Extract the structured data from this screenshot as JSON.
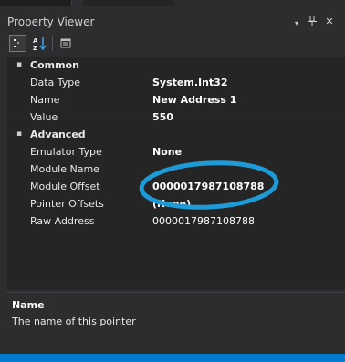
{
  "window": {
    "title": "Property Viewer"
  },
  "titlebar_buttons": {
    "menu_icon": "▾",
    "pin_icon": "ᛘ",
    "close_icon": "✕"
  },
  "toolbar": {
    "categorized_icon": "categorized-icon",
    "alphabetical_icon": "alphabetical-icon",
    "pages_icon": "property-pages-icon"
  },
  "colors": {
    "accent": "#007acc",
    "highlight_ellipse": "#1e9bd7",
    "background": "#2d2d30",
    "grid": "#252526"
  },
  "categories": [
    {
      "name": "Common",
      "expander": "▪",
      "properties": [
        {
          "name": "Data Type",
          "value": "System.Int32"
        },
        {
          "name": "Name",
          "value": "New Address 1"
        },
        {
          "name": "Value",
          "value": "550"
        }
      ]
    },
    {
      "name": "Advanced",
      "expander": "▪",
      "properties": [
        {
          "name": "Emulator Type",
          "value": "None"
        },
        {
          "name": "Module Name",
          "value": ""
        },
        {
          "name": "Module Offset",
          "value": "0000017987108788"
        },
        {
          "name": "Pointer Offsets",
          "value": "(None)"
        },
        {
          "name": "Raw Address",
          "value": "0000017987108788"
        }
      ]
    }
  ],
  "description": {
    "title": "Name",
    "text": "The name of this pointer"
  }
}
